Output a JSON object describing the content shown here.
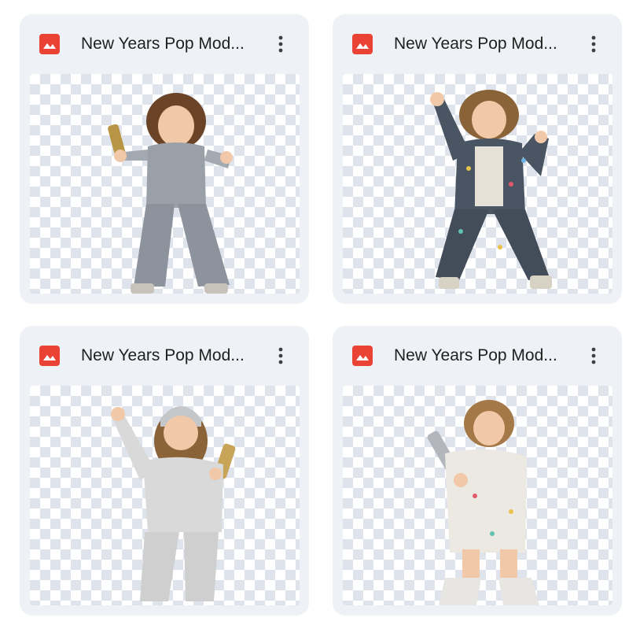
{
  "files": [
    {
      "title": "New Years Pop Mod...",
      "icon": "image-file-icon",
      "menu_icon": "more-vert-icon",
      "outfit": "silver-sequin-suit",
      "outfit_color": "#9aa0a8"
    },
    {
      "title": "New Years Pop Mod...",
      "icon": "image-file-icon",
      "menu_icon": "more-vert-icon",
      "outfit": "dark-fleece-suit",
      "outfit_color": "#4a5563"
    },
    {
      "title": "New Years Pop Mod...",
      "icon": "image-file-icon",
      "menu_icon": "more-vert-icon",
      "outfit": "white-fleece-beanie-suit",
      "outfit_color": "#d9d9d9"
    },
    {
      "title": "New Years Pop Mod...",
      "icon": "image-file-icon",
      "menu_icon": "more-vert-icon",
      "outfit": "white-fluffy-sweater",
      "outfit_color": "#ece8e2"
    }
  ],
  "colors": {
    "card_bg": "#eef1f6",
    "icon_red": "#ea4335",
    "title_text": "#1f1f1f",
    "checker": "#dfe3ec"
  }
}
